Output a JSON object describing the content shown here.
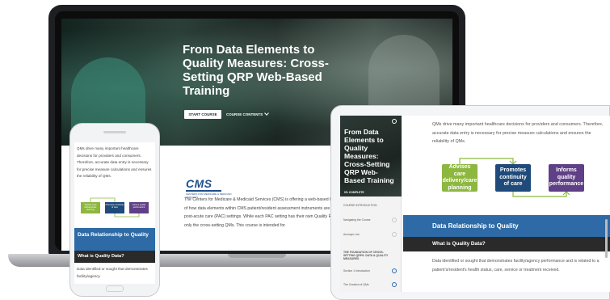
{
  "laptop": {
    "hero_title": "From Data Elements to Quality Measures: Cross-Setting QRP Web-Based Training",
    "start_button": "START COURSE",
    "contents_button": "COURSE CONTENTS",
    "logo": "CMS",
    "logo_tagline": "CENTERS FOR MEDICARE & MEDICAID SERVICES",
    "intro": "The Centers for Medicare & Medicaid Services (CMS) is offering a web-based training course that provides a high-level overview of how data elements within CMS patient/resident assessment instruments are used to construct quality measures (QMs) across post-acute care (PAC) settings. While each PAC setting has their own Quality Reporting Program (QRP), this training will focus on only the cross-setting QMs. This course is intended for"
  },
  "phone": {
    "text": "QMs drive many important healthcare decisions for providers and consumers. Therefore, accurate data entry is necessary for precise measure calculations and ensures the reliability of QMs.",
    "diagram": [
      "Advises care delivery/care planning",
      "Promotes continuity of care",
      "Informs quality performance"
    ],
    "section_heading": "Data Relationship to Quality",
    "sub_heading": "What is Quality Data?",
    "text2": "Data identified or sought that demonstrates facility/agency"
  },
  "tablet": {
    "sidebar_title": "From Data Elements to Quality Measures: Cross-Setting QRP Web-Based Training",
    "progress": "0% COMPLETE",
    "sidebar_items": [
      "COURSE INTRODUCTION",
      "Navigating the Course",
      "Acronym List",
      "THE FOUNDATION OF CROSS-SETTING QRPS: DATA & QUALITY MEASURES",
      "Section 1 Introduction",
      "The Creation of QMs"
    ],
    "text": "QMs drive many important healthcare decisions for providers and consumers. Therefore, accurate data entry is necessary for precise measure calculations and ensures the reliability of QMs.",
    "diagram": [
      "Advises care delivery/care planning",
      "Promotes continuity of care",
      "Informs quality performance"
    ],
    "section_heading": "Data Relationship to Quality",
    "sub_heading": "What is Quality Data?",
    "text2": "Data identified or sought that demonstrates facility/agency performance and is related to a patient's/resident's health status, care, service or treatment received."
  },
  "colors": {
    "green": "#8db73f",
    "dark_blue": "#1f4a7a",
    "purple": "#5f3f86",
    "section_blue": "#2d6aa6"
  }
}
